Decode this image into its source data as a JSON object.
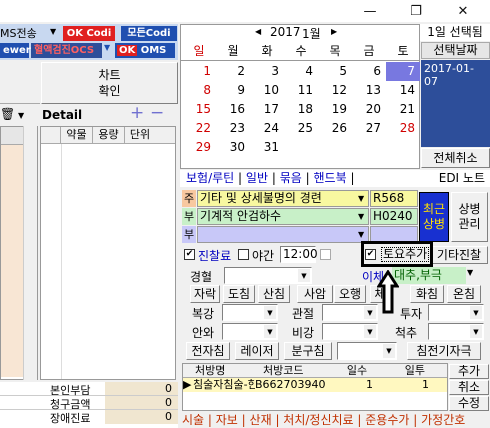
{
  "window": {
    "minimize": "—",
    "restore": "❐",
    "close": "✕"
  },
  "toolbar": {
    "ms_label": "MS전송",
    "ok_codi": "Codi",
    "ok_label": "OK",
    "mode_codi": "모든Codi",
    "viewer": "ewer",
    "ocs_label": "혈액검진OCS",
    "ok_oms": "OMS",
    "dropdown_glyph": "▼"
  },
  "left": {
    "car_label_1": "차트",
    "car_label_2": "확인",
    "detail_title": "Detail",
    "plus": "+",
    "minus": "−",
    "cols": [
      "약물",
      "용량",
      "단위"
    ],
    "trash_dropdown": "▼",
    "summary": [
      {
        "label": "본인부담",
        "value": "0"
      },
      {
        "label": "청구금액",
        "value": "0"
      },
      {
        "label": "장애진료",
        "value": "0"
      }
    ]
  },
  "calendar": {
    "prev": "◀",
    "next": "▶",
    "year": "2017",
    "year_unit": "년",
    "month": "1월",
    "weekdays": [
      "일",
      "월",
      "화",
      "수",
      "목",
      "금",
      "토"
    ],
    "rows": [
      [
        "1",
        "2",
        "3",
        "4",
        "5",
        "6",
        "7"
      ],
      [
        "8",
        "9",
        "10",
        "11",
        "12",
        "13",
        "14"
      ],
      [
        "15",
        "16",
        "17",
        "18",
        "19",
        "20",
        "21"
      ],
      [
        "22",
        "23",
        "24",
        "25",
        "26",
        "27",
        "28"
      ],
      [
        "29",
        "30",
        "31",
        "",
        "",
        "",
        ""
      ]
    ],
    "selected_count": "1일 선택됨",
    "selected_header": "선택날짜",
    "selected_date": "2017-01-07",
    "clear_all": "전체취소"
  },
  "tabs": {
    "items": [
      "보험/루틴",
      "일반",
      "묶음",
      "핸드북"
    ],
    "edi": "EDI 노트"
  },
  "diag": {
    "rows": [
      {
        "tag": "주",
        "name": "기타 및 상세불명의 경련",
        "code": "R568"
      },
      {
        "tag": "부",
        "name": "기계적 안검하수",
        "code": "H0240"
      },
      {
        "tag": "부",
        "name": "",
        "code": ""
      }
    ],
    "blue_btn_1": "최근",
    "blue_btn_2": "상병",
    "side_btn_1": "상병",
    "side_btn_2": "관리"
  },
  "options": {
    "jinryo": "진찰료",
    "night": "야간",
    "time": "12:00",
    "saturday": "토요추가",
    "other": "기타진찰"
  },
  "rx": {
    "labels": {
      "route": "경혈",
      "ichi": "이체",
      "daechu": "대추,부극",
      "rows": [
        "자락",
        "도침",
        "산침",
        "사암",
        "오행",
        "체",
        "화침",
        "온침"
      ],
      "bokgang": "복강",
      "gwanjeol": "관절",
      "tuja": "투자",
      "anwa": "안와",
      "bigang": "비강",
      "cheokchu": "척추",
      "jeonja": "전자침",
      "laser": "레이저",
      "bunguchim": "분구침",
      "chimjeon": "침전기자극"
    }
  },
  "presc": {
    "cols": [
      "처방명",
      "처방코드",
      "일수",
      "일투"
    ],
    "row": {
      "name": "침술자침술-한",
      "code": "B662703940",
      "days": "1",
      "daily": "1"
    },
    "add": "추가",
    "cancel": "취소",
    "edit": "수정",
    "bottom": [
      "시술",
      "자보",
      "산재",
      "처치/정신치료",
      "준용수가",
      "가정간호"
    ]
  }
}
